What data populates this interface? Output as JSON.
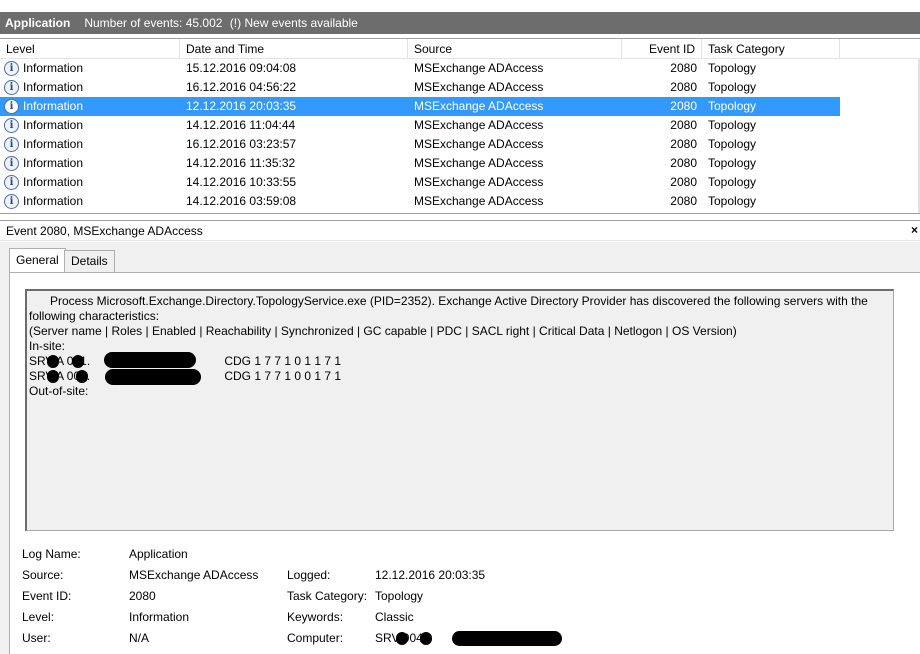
{
  "titlebar": {
    "app": "Application",
    "event_count": "Number of events: 45.002",
    "new_events": "(!) New events available"
  },
  "grid": {
    "columns": [
      "Level",
      "Date and Time",
      "Source",
      "Event ID",
      "Task Category"
    ],
    "rows": [
      {
        "level": "Information",
        "date": "15.12.2016 09:04:08",
        "source": "MSExchange ADAccess",
        "event_id": "2080",
        "task": "Topology"
      },
      {
        "level": "Information",
        "date": "16.12.2016 04:56:22",
        "source": "MSExchange ADAccess",
        "event_id": "2080",
        "task": "Topology"
      },
      {
        "level": "Information",
        "date": "12.12.2016 20:03:35",
        "source": "MSExchange ADAccess",
        "event_id": "2080",
        "task": "Topology",
        "selected": true
      },
      {
        "level": "Information",
        "date": "14.12.2016 11:04:44",
        "source": "MSExchange ADAccess",
        "event_id": "2080",
        "task": "Topology"
      },
      {
        "level": "Information",
        "date": "16.12.2016 03:23:57",
        "source": "MSExchange ADAccess",
        "event_id": "2080",
        "task": "Topology"
      },
      {
        "level": "Information",
        "date": "14.12.2016 11:35:32",
        "source": "MSExchange ADAccess",
        "event_id": "2080",
        "task": "Topology"
      },
      {
        "level": "Information",
        "date": "14.12.2016 10:33:55",
        "source": "MSExchange ADAccess",
        "event_id": "2080",
        "task": "Topology"
      },
      {
        "level": "Information",
        "date": "14.12.2016 03:59:08",
        "source": "MSExchange ADAccess",
        "event_id": "2080",
        "task": "Topology"
      }
    ],
    "level_icon": "information-icon"
  },
  "detail": {
    "header": "Event 2080, MSExchange ADAccess",
    "close_glyph": "×",
    "tabs": [
      "General",
      "Details"
    ],
    "description": {
      "line1": "Process Microsoft.Exchange.Directory.TopologyService.exe (PID=2352). Exchange Active Directory Provider has discovered the following servers with the",
      "line2": "following characteristics:",
      "line3": " (Server name | Roles | Enabled | Reachability | Synchronized | GC capable | PDC | SACL right | Critical Data | Netlogon | OS Version)",
      "in_site": "In-site:",
      "server1_prefix": "SRV  A  001.",
      "server1_cdg": "CDG 1 7 7 1 0 1 1 7 1",
      "server2_prefix": "SRV  A  003.",
      "server2_cdg": "CDG 1 7 7 1 0 0 1 7 1",
      "out_of_site": "Out-of-site:"
    },
    "props": {
      "log_name_label": "Log Name:",
      "log_name": "Application",
      "source_label": "Source:",
      "source": "MSExchange ADAccess",
      "logged_label": "Logged:",
      "logged": "12.12.2016 20:03:35",
      "event_id_label": "Event ID:",
      "event_id": "2080",
      "task_label": "Task Category:",
      "task": "Topology",
      "level_label": "Level:",
      "level": "Information",
      "keywords_label": "Keywords:",
      "keywords": "Classic",
      "user_label": "User:",
      "user": "N/A",
      "computer_label": "Computer:",
      "computer": "SRV    004."
    }
  },
  "colors": {
    "titlebar": "#6d6d6d",
    "selection": "#3399ff",
    "panel": "#f0f0f0"
  }
}
